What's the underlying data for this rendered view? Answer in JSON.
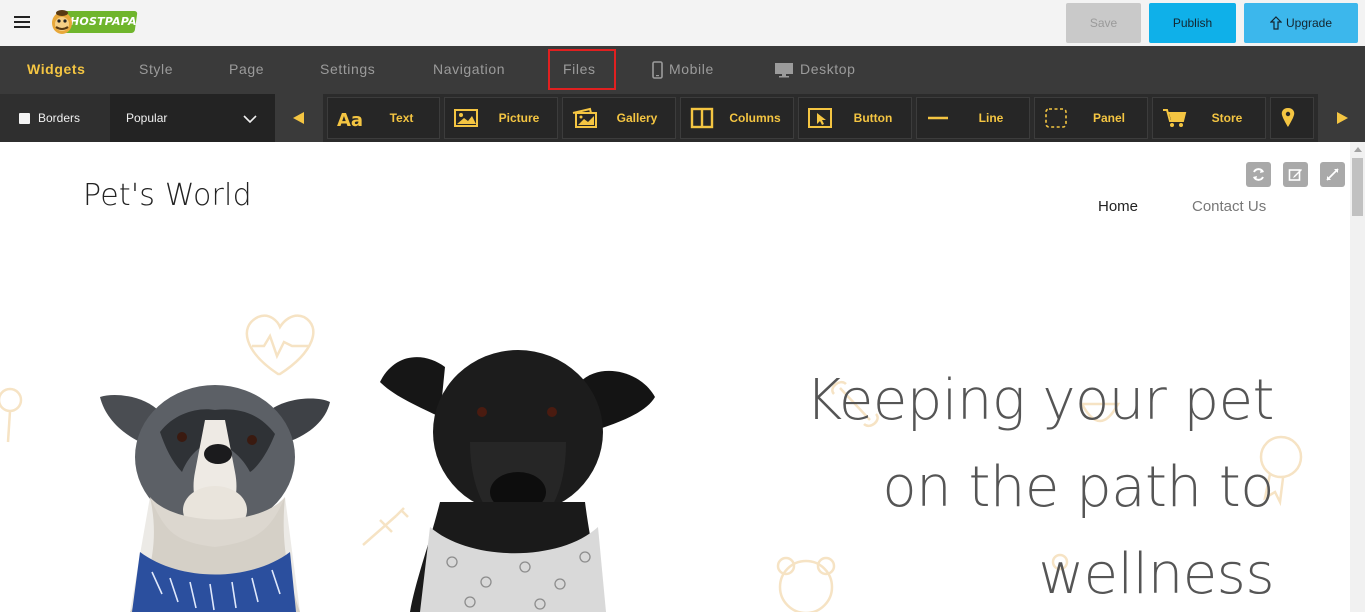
{
  "topbar": {
    "logo_text": "HOSTPAPA",
    "save_label": "Save",
    "publish_label": "Publish",
    "upgrade_label": "Upgrade"
  },
  "tabs": [
    {
      "label": "Widgets",
      "active": true
    },
    {
      "label": "Style"
    },
    {
      "label": "Page"
    },
    {
      "label": "Settings"
    },
    {
      "label": "Navigation"
    },
    {
      "label": "Files",
      "highlighted": true
    },
    {
      "label": "Mobile",
      "icon": "mobile-icon"
    },
    {
      "label": "Desktop",
      "icon": "desktop-icon"
    }
  ],
  "widgetbar": {
    "borders_label": "Borders",
    "category_selected": "Popular",
    "widgets": [
      {
        "label": "Text",
        "icon": "text-icon"
      },
      {
        "label": "Picture",
        "icon": "picture-icon"
      },
      {
        "label": "Gallery",
        "icon": "gallery-icon"
      },
      {
        "label": "Columns",
        "icon": "columns-icon"
      },
      {
        "label": "Button",
        "icon": "cursor-icon"
      },
      {
        "label": "Line",
        "icon": "line-icon"
      },
      {
        "label": "Panel",
        "icon": "panel-icon"
      },
      {
        "label": "Store",
        "icon": "cart-icon"
      },
      {
        "label": "",
        "icon": "map-pin-icon"
      }
    ]
  },
  "site": {
    "title": "Pet's World",
    "nav": [
      "Home",
      "Contact Us"
    ],
    "hero_lines": [
      "Keeping your pet",
      "on the path to",
      "wellness"
    ]
  },
  "colors": {
    "accent": "#f4c542",
    "tabbar_bg": "#3a3a3a",
    "publish": "#0fb0e9",
    "highlight": "#e02020"
  }
}
